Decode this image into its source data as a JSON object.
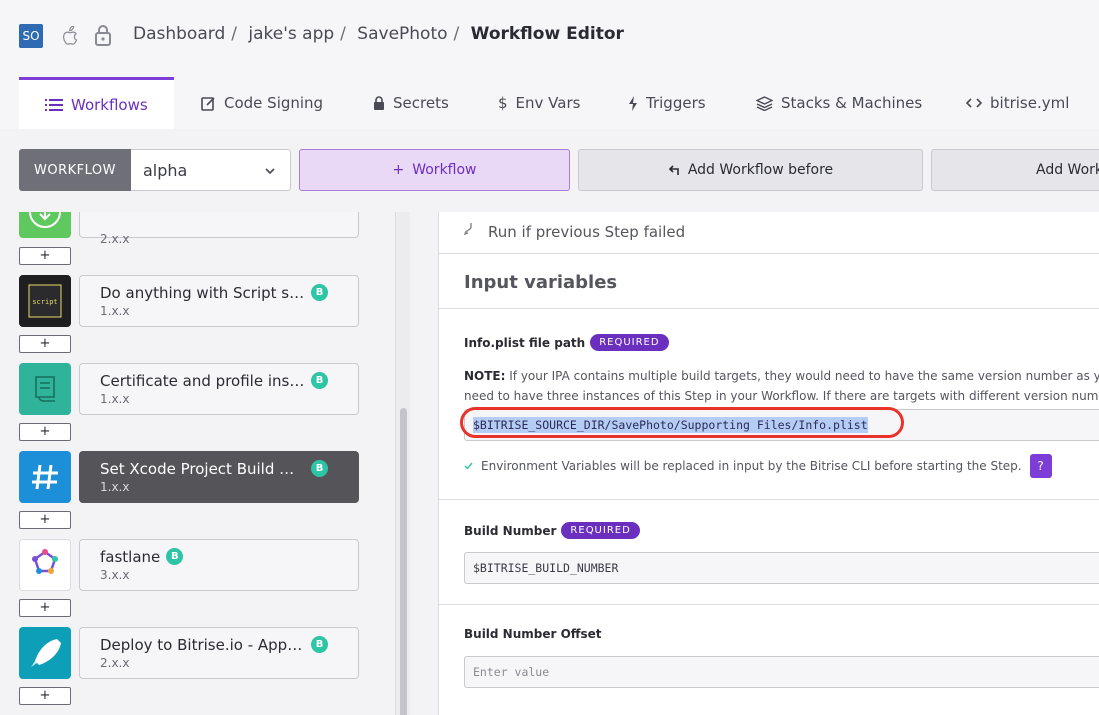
{
  "header": {
    "avatar": "SO",
    "breadcrumbs": [
      "Dashboard",
      "jake's app",
      "SavePhoto"
    ],
    "separator": "/",
    "current": "Workflow Editor"
  },
  "tabs": [
    {
      "label": "Workflows",
      "icon": "list-icon",
      "active": true
    },
    {
      "label": "Code Signing",
      "icon": "document-edit-icon"
    },
    {
      "label": "Secrets",
      "icon": "lock-icon"
    },
    {
      "label": "Env Vars",
      "icon": "dollar-icon"
    },
    {
      "label": "Triggers",
      "icon": "bolt-icon"
    },
    {
      "label": "Stacks & Machines",
      "icon": "layers-icon"
    },
    {
      "label": "bitrise.yml",
      "icon": "code-icon"
    }
  ],
  "workflow_bar": {
    "label": "WORKFLOW",
    "selected": "alpha",
    "add_workflow": "Workflow",
    "add_before": "Add Workflow before",
    "add_after": "Add Workflow after"
  },
  "steps": [
    {
      "title": "",
      "version": "2.x.x",
      "icon": "download-icon",
      "color": "#5fc95f"
    },
    {
      "title": "Do anything with Script step",
      "version": "1.x.x",
      "icon": "script-icon",
      "color": "#1f1f22",
      "badge": "B"
    },
    {
      "title": "Certificate and profile installer",
      "version": "1.x.x",
      "icon": "certificate-icon",
      "color": "#2fb39a",
      "badge": "B"
    },
    {
      "title": "Set Xcode Project Build Number",
      "version": "1.x.x",
      "icon": "hash-icon",
      "color": "#1d8fd8",
      "badge": "B",
      "selected": true
    },
    {
      "title": "fastlane",
      "version": "3.x.x",
      "icon": "fastlane-icon",
      "color": "#ffffff",
      "badge": "B"
    },
    {
      "title": "Deploy to Bitrise.io - Apps, Logs, Artifacts",
      "version": "2.x.x",
      "icon": "rocket-icon",
      "color": "#0d9fb8",
      "badge": "B"
    }
  ],
  "plus_label": "+",
  "detail": {
    "run_if_failed": "Run if previous Step failed",
    "section_title": "Input variables",
    "required_label": "REQUIRED",
    "info_plist": {
      "label": "Info.plist file path",
      "note_bold": "NOTE:",
      "note_line1": " If your IPA contains multiple build targets, they would need to have the same version number as your a",
      "note_line2": "need to have three instances of this Step in your Workflow. If there are targets with different version numbers",
      "value": "$BITRISE_SOURCE_DIR/SavePhoto/Supporting Files/Info.plist"
    },
    "env_note": "Environment Variables will be replaced in input by the Bitrise CLI before starting the Step.",
    "help": "?",
    "build_number": {
      "label": "Build Number",
      "value": "$BITRISE_BUILD_NUMBER"
    },
    "build_number_offset": {
      "label": "Build Number Offset",
      "placeholder": "Enter value"
    }
  },
  "colors": {
    "accent": "#6a2fbf",
    "highlight_ring": "#e8332a",
    "badge": "#2ec4a6"
  }
}
